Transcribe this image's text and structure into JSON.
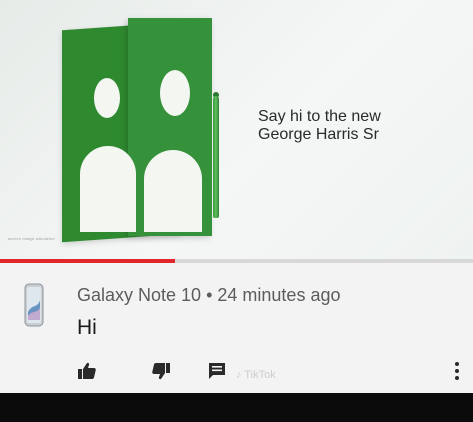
{
  "video": {
    "headline_line1": "Say hi to the new",
    "headline_line2": "George Harris Sr",
    "small_caption": "screen image simulated",
    "progress_fraction": 0.37,
    "colors": {
      "green_primary": "#35913a",
      "green_secondary": "#2f8a2f",
      "progress": "#e3262c"
    }
  },
  "comment": {
    "author": "Galaxy Note 10",
    "separator": "•",
    "time": "24 minutes ago",
    "text": "Hi",
    "actions": {
      "like_icon": "thumbs-up-icon",
      "dislike_icon": "thumbs-down-icon",
      "reply_icon": "comment-icon",
      "more_icon": "more-vertical-icon"
    }
  },
  "watermark": {
    "text": "TikTok"
  }
}
